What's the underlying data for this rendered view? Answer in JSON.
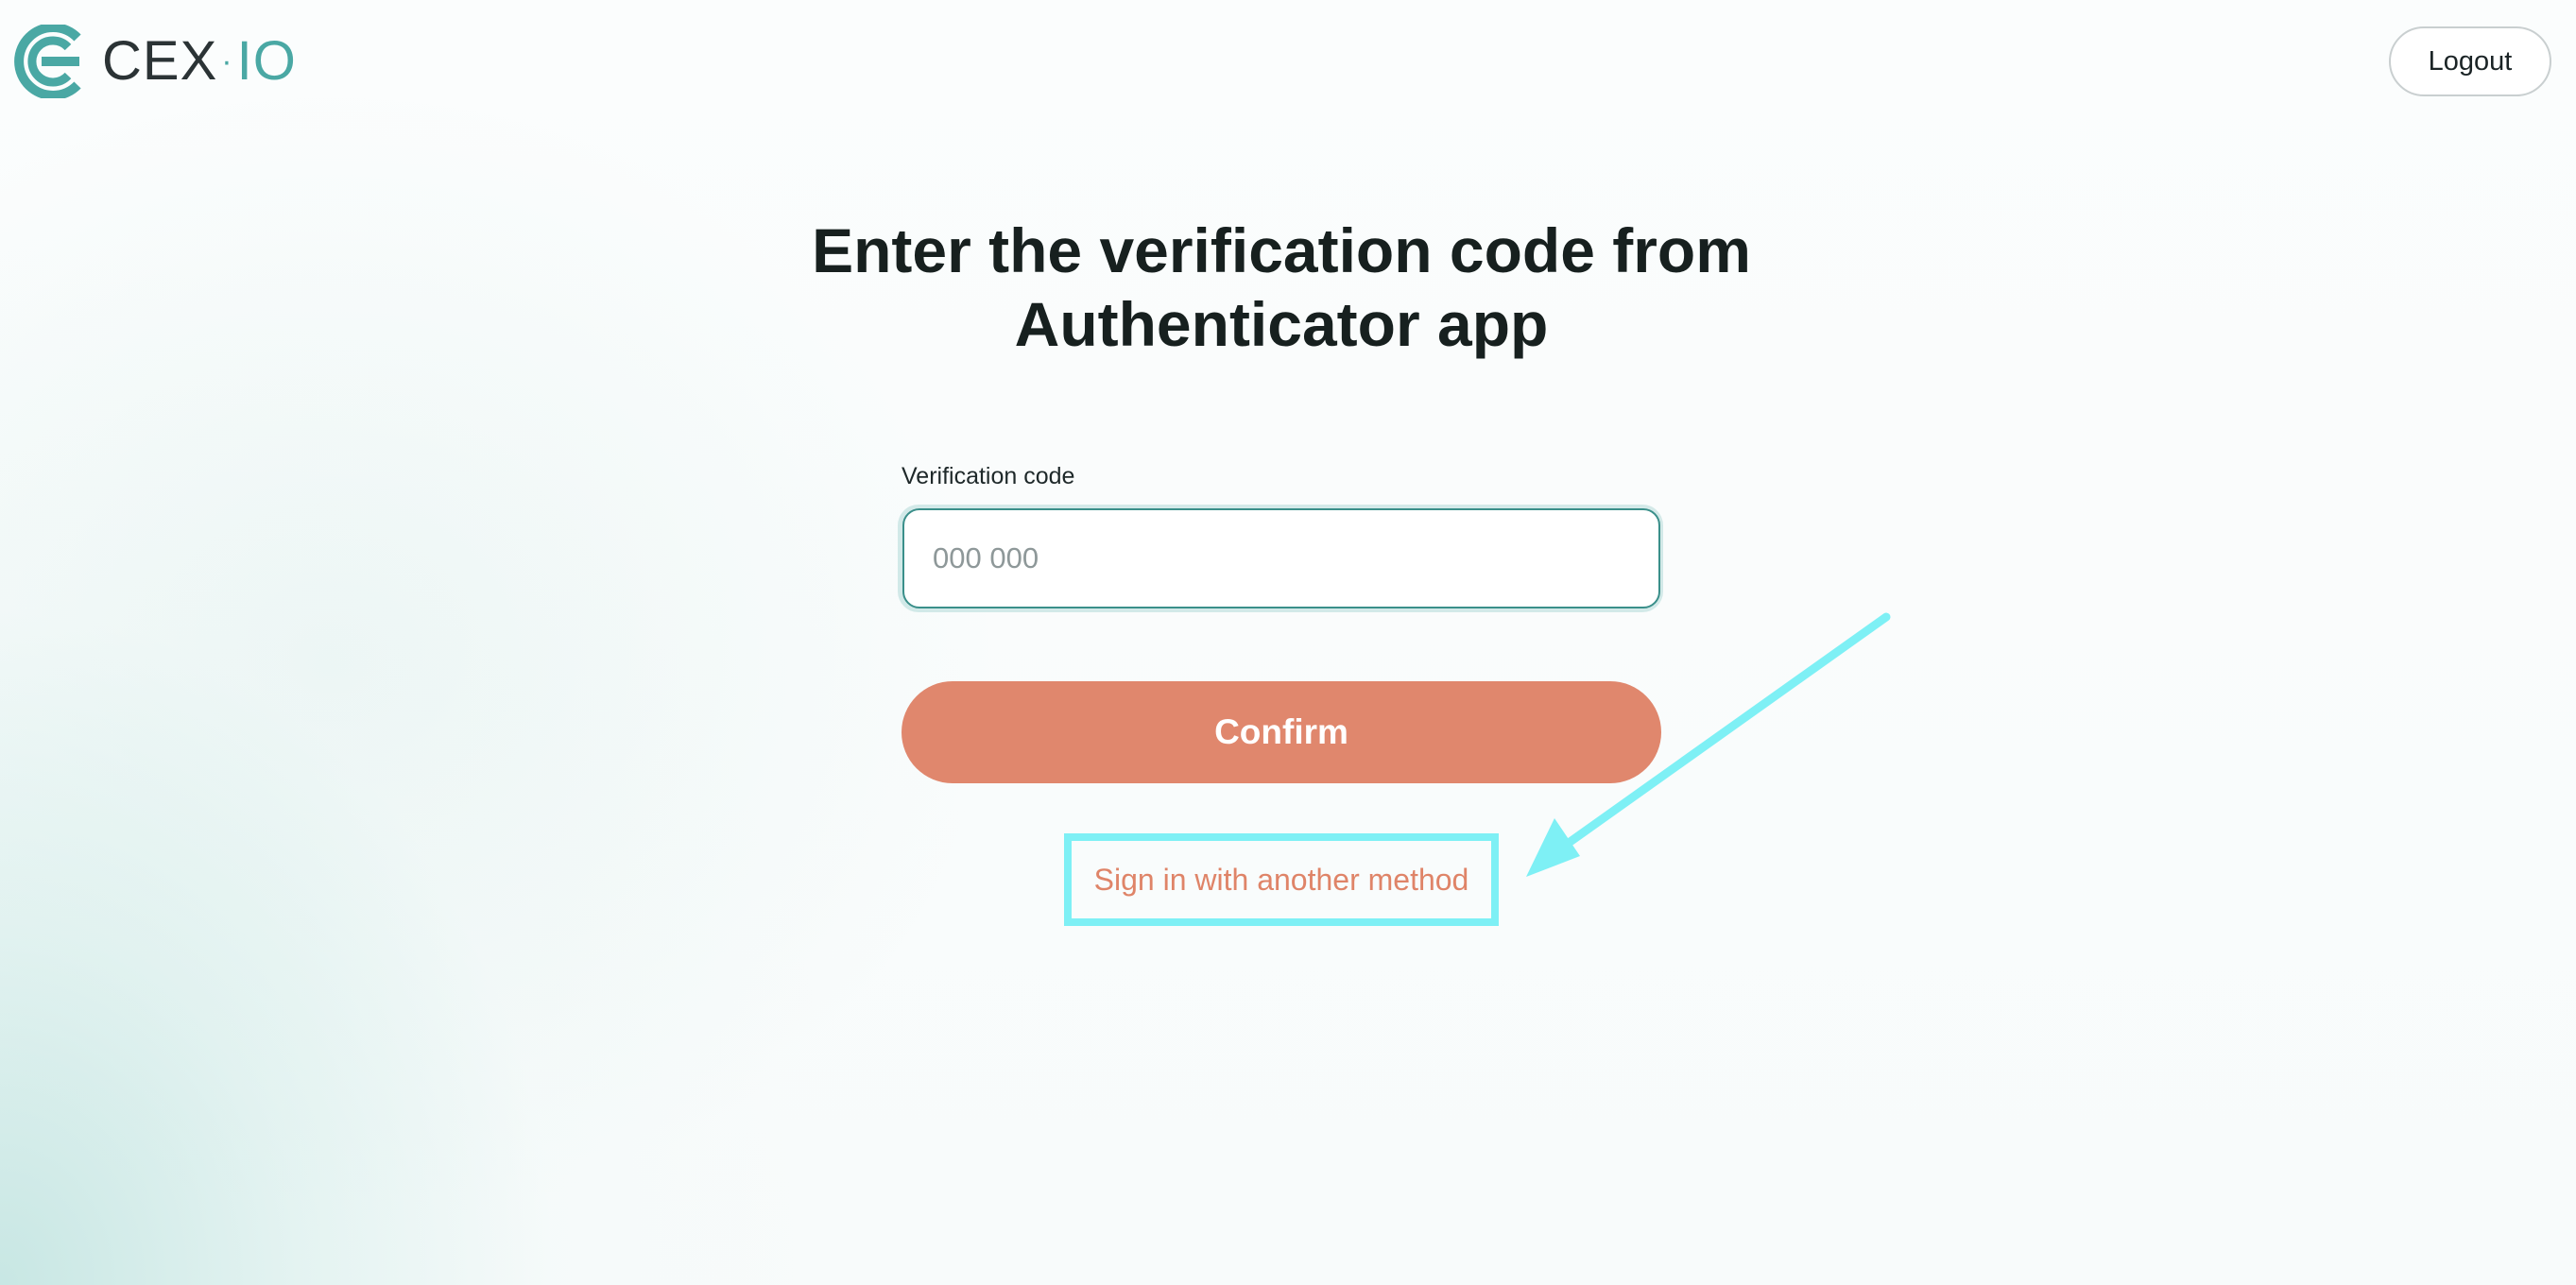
{
  "brand": {
    "name_main": "CEX",
    "name_separator": "·",
    "name_suffix": "IO",
    "accent_color": "#4aa8a4"
  },
  "header": {
    "logout_label": "Logout"
  },
  "main": {
    "title_line1": "Enter the verification code from",
    "title_line2": "Authenticator app",
    "code_field": {
      "label": "Verification code",
      "placeholder": "000 000",
      "value": ""
    },
    "confirm_label": "Confirm",
    "alt_method_label": "Sign in with another method"
  },
  "colors": {
    "confirm_button": "#e0876d",
    "link": "#df8468",
    "highlight_annotation": "#7ef0f5"
  },
  "icons": {
    "logo": "cex-io-logo-icon",
    "annotation": "arrow-annotation-icon"
  }
}
